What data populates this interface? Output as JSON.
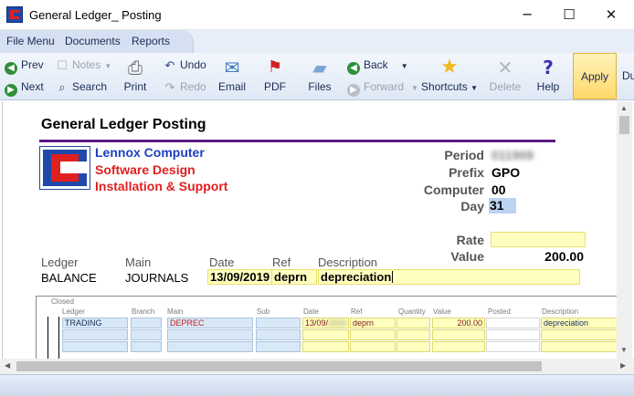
{
  "window": {
    "title": "General Ledger_ Posting",
    "minimize_glyph": "─",
    "maximize_glyph": "☐",
    "close_glyph": "✕"
  },
  "menu": {
    "items": [
      "File Menu",
      "Documents",
      "Reports"
    ]
  },
  "toolbar": {
    "prev": "Prev",
    "next": "Next",
    "notes": "Notes",
    "search": "Search",
    "print": "Print",
    "undo": "Undo",
    "redo": "Redo",
    "email": "Email",
    "pdf": "PDF",
    "files": "Files",
    "back": "Back",
    "forward": "Forward",
    "shortcuts": "Shortcuts",
    "delete": "Delete",
    "help": "Help",
    "apply": "Apply",
    "cut_off": "Du"
  },
  "form": {
    "title": "General Ledger Posting",
    "company": {
      "line1": "Lennox Computer",
      "line2": "Software Design",
      "line3": "Installation & Support"
    },
    "period_label": "Period",
    "period_value": "011909",
    "prefix_label": "Prefix",
    "prefix_value": "GPO",
    "computer_label": "Computer",
    "computer_value": "00",
    "day_label": "Day",
    "day_value": "31",
    "rate_label": "Rate",
    "rate_value": "",
    "value_label": "Value",
    "value_value": "200.00",
    "ledger_label": "Ledger",
    "ledger_value": "BALANCE",
    "main_label": "Main",
    "main_value": "JOURNALS",
    "date_label": "Date",
    "date_value": "13/09/2019",
    "ref_label": "Ref",
    "ref_value": "deprn",
    "desc_label": "Description",
    "desc_value": "depreciation"
  },
  "grid": {
    "closed_label": "Closed",
    "headers": [
      "Ledger",
      "Branch",
      "Main",
      "Sub",
      "Date",
      "Ref",
      "Quantity",
      "Value",
      "Posted",
      "Description"
    ],
    "rows": [
      {
        "ledger": "TRADING",
        "branch": "",
        "main": "DEPREC",
        "sub": "",
        "date": "13/09/",
        "date_hidden": "2019",
        "ref": "deprn",
        "quantity": "",
        "value": "200.00",
        "posted": "",
        "description": "depreciation"
      }
    ]
  }
}
